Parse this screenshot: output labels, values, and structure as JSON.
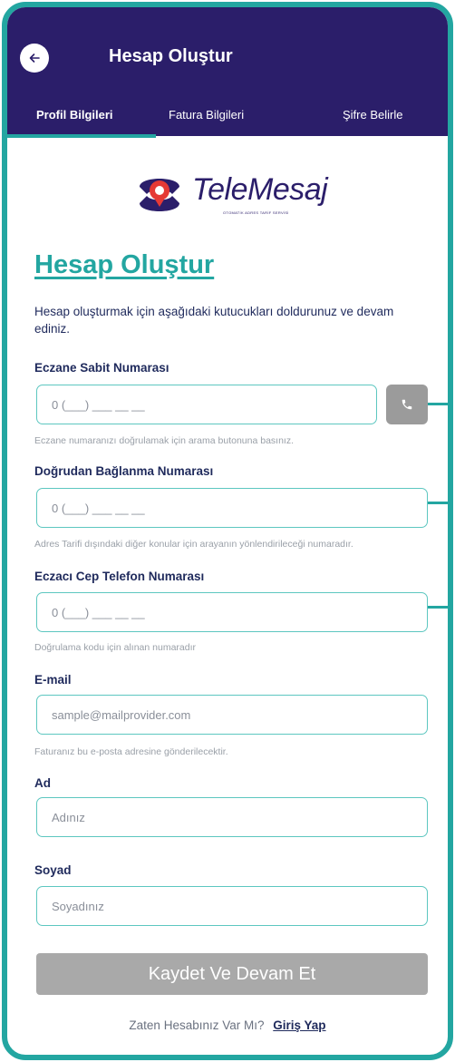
{
  "header": {
    "title": "Hesap Oluştur",
    "back_icon": "arrow-left-icon"
  },
  "tabs": [
    {
      "label": "Profil Bilgileri",
      "active": true
    },
    {
      "label": "Fatura Bilgileri",
      "active": false
    },
    {
      "label": "Şifre Belirle",
      "active": false
    }
  ],
  "logo": {
    "name": "TeleMesaj",
    "tagline": "OTOMATİK ADRES TARİF SERVİSİ",
    "icon": "phone-location-pin-logo-icon"
  },
  "form": {
    "title": "Hesap Oluştur",
    "intro": "Hesap oluşturmak için aşağıdaki kutucukları doldurunuz ve devam ediniz.",
    "fields": [
      {
        "label": "Eczane Sabit Numarası",
        "placeholder": "0 (___) ___ __ __",
        "hint": "Eczane numaranızı doğrulamak için arama butonuna basınız."
      },
      {
        "label": "Doğrudan Bağlanma Numarası",
        "placeholder": "0 (___) ___ __ __",
        "hint": "Adres Tarifi dışındaki diğer konular için arayanın yönlendirileceği numaradır."
      },
      {
        "label": "Eczacı Cep Telefon Numarası",
        "placeholder": "0 (___) ___ __ __",
        "hint": "Doğrulama kodu için alınan numaradır"
      },
      {
        "label": "E-mail",
        "placeholder": "sample@mailprovider.com",
        "hint": "Faturanız bu e-posta adresine gönderilecektir."
      },
      {
        "label": "Ad",
        "placeholder": "Adınız"
      },
      {
        "label": "Soyad",
        "placeholder": "Soyadınız"
      }
    ],
    "call_button_icon": "phone-icon",
    "submit_label": "Kaydet Ve Devam Et",
    "footer_text": "Zaten Hesabınız Var Mı?",
    "login_link": "Giriş Yap"
  },
  "colors": {
    "header_bg": "#2b1e6a",
    "accent": "#23a6a1",
    "text": "#1f2a5c",
    "button_disabled": "#a9a9a9",
    "call_button": "#9b9b9b"
  }
}
